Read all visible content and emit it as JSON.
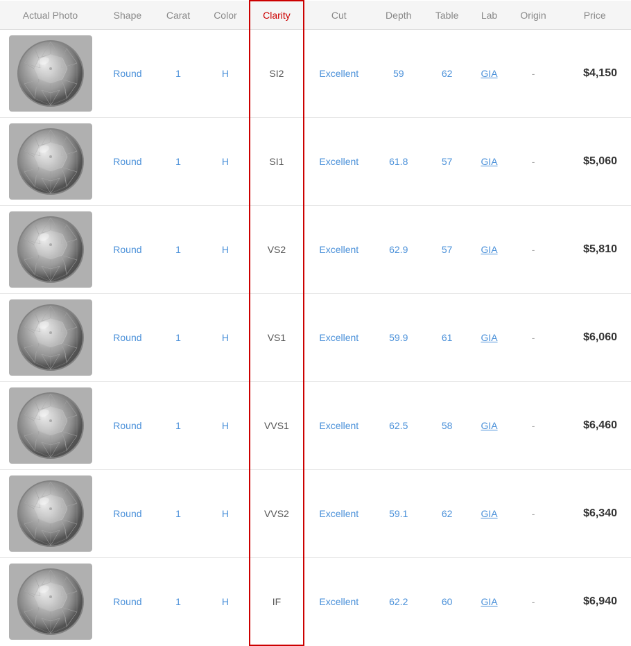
{
  "header": {
    "columns": [
      {
        "label": "Actual Photo",
        "key": "actual_photo"
      },
      {
        "label": "Shape",
        "key": "shape"
      },
      {
        "label": "Carat",
        "key": "carat"
      },
      {
        "label": "Color",
        "key": "color"
      },
      {
        "label": "Clarity",
        "key": "clarity"
      },
      {
        "label": "Cut",
        "key": "cut"
      },
      {
        "label": "Depth",
        "key": "depth"
      },
      {
        "label": "Table",
        "key": "table"
      },
      {
        "label": "Lab",
        "key": "lab"
      },
      {
        "label": "Origin",
        "key": "origin"
      },
      {
        "label": "Price",
        "key": "price"
      }
    ]
  },
  "rows": [
    {
      "shape": "Round",
      "carat": "1",
      "color": "H",
      "clarity": "SI2",
      "cut": "Excellent",
      "depth": "59",
      "table": "62",
      "lab": "GIA",
      "origin": "-",
      "price": "$4,150"
    },
    {
      "shape": "Round",
      "carat": "1",
      "color": "H",
      "clarity": "SI1",
      "cut": "Excellent",
      "depth": "61.8",
      "table": "57",
      "lab": "GIA",
      "origin": "-",
      "price": "$5,060"
    },
    {
      "shape": "Round",
      "carat": "1",
      "color": "H",
      "clarity": "VS2",
      "cut": "Excellent",
      "depth": "62.9",
      "table": "57",
      "lab": "GIA",
      "origin": "-",
      "price": "$5,810"
    },
    {
      "shape": "Round",
      "carat": "1",
      "color": "H",
      "clarity": "VS1",
      "cut": "Excellent",
      "depth": "59.9",
      "table": "61",
      "lab": "GIA",
      "origin": "-",
      "price": "$6,060"
    },
    {
      "shape": "Round",
      "carat": "1",
      "color": "H",
      "clarity": "VVS1",
      "cut": "Excellent",
      "depth": "62.5",
      "table": "58",
      "lab": "GIA",
      "origin": "-",
      "price": "$6,460"
    },
    {
      "shape": "Round",
      "carat": "1",
      "color": "H",
      "clarity": "VVS2",
      "cut": "Excellent",
      "depth": "59.1",
      "table": "62",
      "lab": "GIA",
      "origin": "-",
      "price": "$6,340"
    },
    {
      "shape": "Round",
      "carat": "1",
      "color": "H",
      "clarity": "IF",
      "cut": "Excellent",
      "depth": "62.2",
      "table": "60",
      "lab": "GIA",
      "origin": "-",
      "price": "$6,940"
    }
  ]
}
